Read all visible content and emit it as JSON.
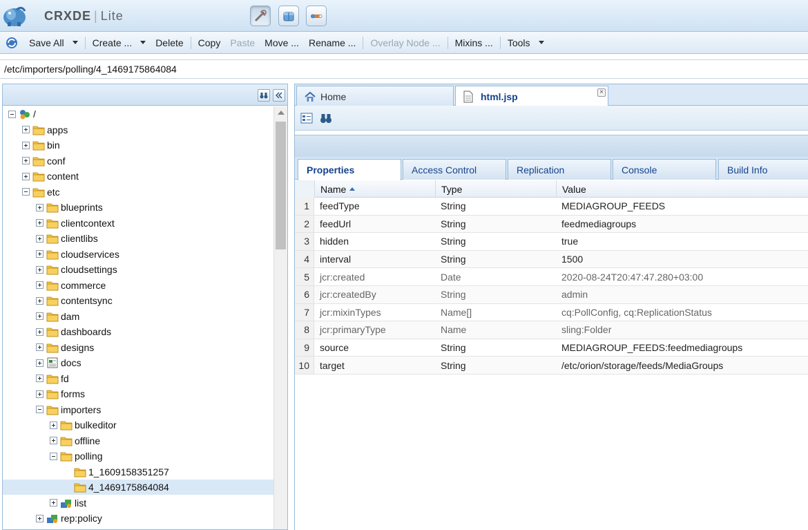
{
  "app": {
    "title_main": "CRXDE",
    "title_sep": "|",
    "title_lite": "Lite"
  },
  "toolbar": {
    "save_all": "Save All",
    "create": "Create ...",
    "delete": "Delete",
    "copy": "Copy",
    "paste": "Paste",
    "move": "Move ...",
    "rename": "Rename ...",
    "overlay_node": "Overlay Node ...",
    "mixins": "Mixins ...",
    "tools": "Tools"
  },
  "path": {
    "value": "/etc/importers/polling/4_1469175864084"
  },
  "tree": {
    "nodes": [
      {
        "label": "/",
        "level": 0,
        "toggle": "minus",
        "icon": "root-icon"
      },
      {
        "label": "apps",
        "level": 1,
        "toggle": "plus",
        "icon": "folder-icon"
      },
      {
        "label": "bin",
        "level": 1,
        "toggle": "plus",
        "icon": "folder-icon"
      },
      {
        "label": "conf",
        "level": 1,
        "toggle": "plus",
        "icon": "folder-icon"
      },
      {
        "label": "content",
        "level": 1,
        "toggle": "plus",
        "icon": "folder-icon"
      },
      {
        "label": "etc",
        "level": 1,
        "toggle": "minus",
        "icon": "folder-icon"
      },
      {
        "label": "blueprints",
        "level": 2,
        "toggle": "plus",
        "icon": "folder-icon"
      },
      {
        "label": "clientcontext",
        "level": 2,
        "toggle": "plus",
        "icon": "folder-icon"
      },
      {
        "label": "clientlibs",
        "level": 2,
        "toggle": "plus",
        "icon": "folder-icon"
      },
      {
        "label": "cloudservices",
        "level": 2,
        "toggle": "plus",
        "icon": "folder-icon"
      },
      {
        "label": "cloudsettings",
        "level": 2,
        "toggle": "plus",
        "icon": "folder-icon"
      },
      {
        "label": "commerce",
        "level": 2,
        "toggle": "plus",
        "icon": "folder-icon"
      },
      {
        "label": "contentsync",
        "level": 2,
        "toggle": "plus",
        "icon": "folder-icon"
      },
      {
        "label": "dam",
        "level": 2,
        "toggle": "plus",
        "icon": "folder-icon"
      },
      {
        "label": "dashboards",
        "level": 2,
        "toggle": "plus",
        "icon": "folder-icon"
      },
      {
        "label": "designs",
        "level": 2,
        "toggle": "plus",
        "icon": "folder-icon"
      },
      {
        "label": "docs",
        "level": 2,
        "toggle": "plus",
        "icon": "page-icon"
      },
      {
        "label": "fd",
        "level": 2,
        "toggle": "plus",
        "icon": "folder-icon"
      },
      {
        "label": "forms",
        "level": 2,
        "toggle": "plus",
        "icon": "folder-icon"
      },
      {
        "label": "importers",
        "level": 2,
        "toggle": "minus",
        "icon": "folder-icon"
      },
      {
        "label": "bulkeditor",
        "level": 3,
        "toggle": "plus",
        "icon": "folder-icon"
      },
      {
        "label": "offline",
        "level": 3,
        "toggle": "plus",
        "icon": "folder-icon"
      },
      {
        "label": "polling",
        "level": 3,
        "toggle": "minus",
        "icon": "folder-icon"
      },
      {
        "label": "1_1609158351257",
        "level": 4,
        "toggle": "none",
        "icon": "folder-icon"
      },
      {
        "label": "4_1469175864084",
        "level": 4,
        "toggle": "none",
        "icon": "folder-icon",
        "selected": true
      },
      {
        "label": "list",
        "level": 3,
        "toggle": "plus",
        "icon": "node-icon"
      },
      {
        "label": "rep:policy",
        "level": 2,
        "toggle": "plus",
        "icon": "node-icon"
      }
    ]
  },
  "editor_tabs": {
    "home": "Home",
    "html_jsp": "html.jsp",
    "close": "×"
  },
  "prop_tabs": {
    "properties": "Properties",
    "access_control": "Access Control",
    "replication": "Replication",
    "console": "Console",
    "build_info": "Build Info"
  },
  "grid": {
    "headers": {
      "name": "Name",
      "type": "Type",
      "value": "Value"
    },
    "rows": [
      {
        "num": "1",
        "name": "feedType",
        "type": "String",
        "value": "MEDIAGROUP_FEEDS",
        "protected": false
      },
      {
        "num": "2",
        "name": "feedUrl",
        "type": "String",
        "value": "feedmediagroups",
        "protected": false
      },
      {
        "num": "3",
        "name": "hidden",
        "type": "String",
        "value": "true",
        "protected": false
      },
      {
        "num": "4",
        "name": "interval",
        "type": "String",
        "value": "1500",
        "protected": false
      },
      {
        "num": "5",
        "name": "jcr:created",
        "type": "Date",
        "value": "2020-08-24T20:47:47.280+03:00",
        "protected": true
      },
      {
        "num": "6",
        "name": "jcr:createdBy",
        "type": "String",
        "value": "admin",
        "protected": true
      },
      {
        "num": "7",
        "name": "jcr:mixinTypes",
        "type": "Name[]",
        "value": "cq:PollConfig, cq:ReplicationStatus",
        "protected": true
      },
      {
        "num": "8",
        "name": "jcr:primaryType",
        "type": "Name",
        "value": "sling:Folder",
        "protected": true
      },
      {
        "num": "9",
        "name": "source",
        "type": "String",
        "value": "MEDIAGROUP_FEEDS:feedmediagroups",
        "protected": false
      },
      {
        "num": "10",
        "name": "target",
        "type": "String",
        "value": "/etc/orion/storage/feeds/MediaGroups",
        "protected": false
      }
    ]
  },
  "colors": {
    "accent": "#15428b",
    "folder": "#f5c542",
    "selection": "#d9e8f6"
  }
}
